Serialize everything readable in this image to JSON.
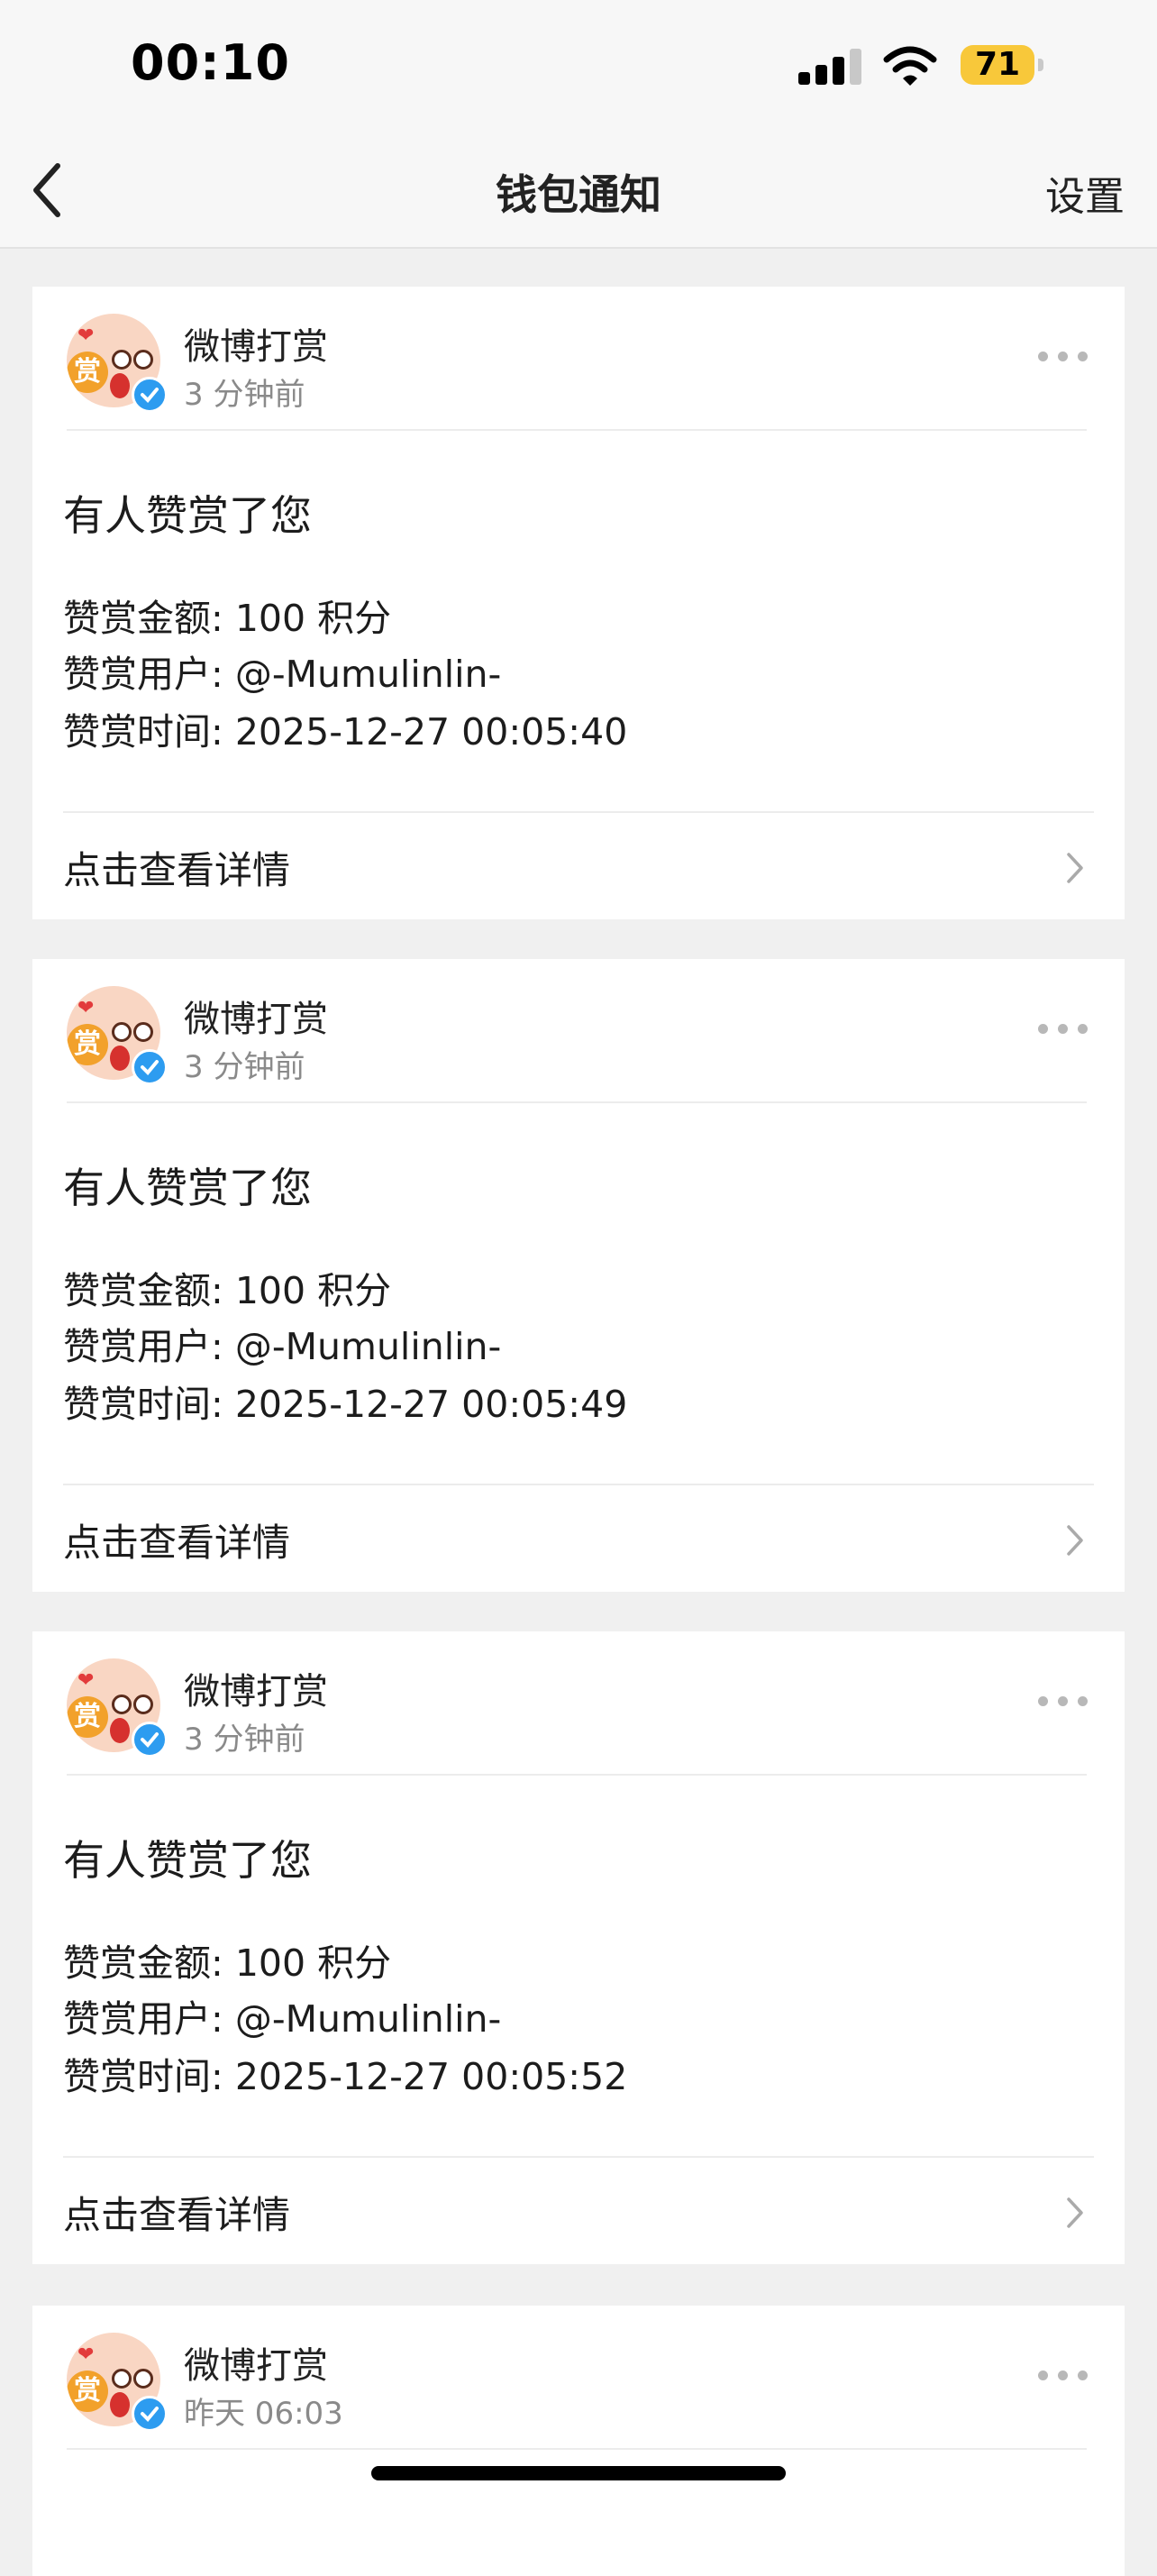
{
  "status_bar": {
    "time": "00:10",
    "battery": "71"
  },
  "nav": {
    "title": "钱包通知",
    "settings_label": "设置"
  },
  "avatar": {
    "badge_char": "赏",
    "heart": "❤"
  },
  "notifications": [
    {
      "sender": "微博打赏",
      "time_ago": "3 分钟前",
      "heading": "有人赞赏了您",
      "amount_line": "赞赏金额: 100 积分",
      "user_line": "赞赏用户: @-Mumulinlin-",
      "time_line": "赞赏时间: 2025-12-27 00:05:40",
      "link_label": "点击查看详情"
    },
    {
      "sender": "微博打赏",
      "time_ago": "3 分钟前",
      "heading": "有人赞赏了您",
      "amount_line": "赞赏金额: 100 积分",
      "user_line": "赞赏用户: @-Mumulinlin-",
      "time_line": "赞赏时间: 2025-12-27 00:05:49",
      "link_label": "点击查看详情"
    },
    {
      "sender": "微博打赏",
      "time_ago": "3 分钟前",
      "heading": "有人赞赏了您",
      "amount_line": "赞赏金额: 100 积分",
      "user_line": "赞赏用户: @-Mumulinlin-",
      "time_line": "赞赏时间: 2025-12-27 00:05:52",
      "link_label": "点击查看详情"
    },
    {
      "sender": "微博打赏",
      "time_ago": "昨天 06:03"
    }
  ]
}
